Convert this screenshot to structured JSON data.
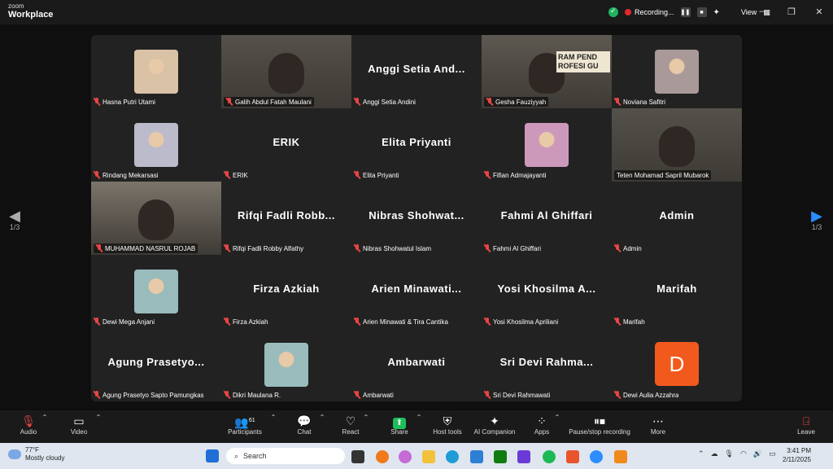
{
  "app": {
    "brand_top": "zoom",
    "brand_bottom": "Workplace",
    "recording_label": "Recording...",
    "view_label": "View"
  },
  "page_indicator": {
    "left": "1/3",
    "right": "1/3"
  },
  "tiles": [
    {
      "label": "Hasna Putri Utami",
      "type": "photo"
    },
    {
      "label": "Galih Abdul Fatah Maulani",
      "type": "video"
    },
    {
      "label": "Anggi Setia Andini",
      "type": "name",
      "big": "Anggi Setia And..."
    },
    {
      "label": "Gesha Fauziyyah",
      "type": "video",
      "sign": "RAM PEND ROFESI GU"
    },
    {
      "label": "Noviana Safitri",
      "type": "photo"
    },
    {
      "label": "Rindang Mekarsasi",
      "type": "photo"
    },
    {
      "label": "ERIK",
      "type": "name",
      "big": "ERIK"
    },
    {
      "label": "Elita Priyanti",
      "type": "name",
      "big": "Elita Priyanti"
    },
    {
      "label": "Fifian Admajayanti",
      "type": "photo"
    },
    {
      "label": "Teten Mohamad Sapril Mubarok",
      "type": "video",
      "active": true
    },
    {
      "label": "MUHAMMAD NASRUL ROJAB",
      "type": "video"
    },
    {
      "label": "Rifqi Fadli Robby Alfathy",
      "type": "name",
      "big": "Rifqi Fadli Robb..."
    },
    {
      "label": "Nibras Shohwatul Islam",
      "type": "name",
      "big": "Nibras Shohwat..."
    },
    {
      "label": "Fahmi Al Ghiffari",
      "type": "name",
      "big": "Fahmi Al Ghiffari"
    },
    {
      "label": "Admin",
      "type": "name",
      "big": "Admin"
    },
    {
      "label": "Dewi Mega Anjani",
      "type": "photo"
    },
    {
      "label": "Firza Azkiah",
      "type": "name",
      "big": "Firza Azkiah"
    },
    {
      "label": "Arien Minawati & Tira Cantika",
      "type": "name",
      "big": "Arien Minawati..."
    },
    {
      "label": "Yosi Khosilma Apriliani",
      "type": "name",
      "big": "Yosi Khosilma A..."
    },
    {
      "label": "Marifah",
      "type": "name",
      "big": "Marifah"
    },
    {
      "label": "Agung Prasetyo Sapto Pamungkas",
      "type": "name",
      "big": "Agung Prasetyo..."
    },
    {
      "label": "Dikri Maulana R.",
      "type": "photo"
    },
    {
      "label": "Ambarwati",
      "type": "name",
      "big": "Ambarwati"
    },
    {
      "label": "Sri Devi Rahmawati",
      "type": "name",
      "big": "Sri Devi Rahma..."
    },
    {
      "label": "Dewi Aulia Azzahra",
      "type": "letter",
      "letter": "D"
    }
  ],
  "toolbar": {
    "audio": "Audio",
    "video": "Video",
    "participants": "Participants",
    "participants_count": "61",
    "chat": "Chat",
    "react": "React",
    "share": "Share",
    "host_tools": "Host tools",
    "ai_companion": "AI Companion",
    "apps": "Apps",
    "pause_stop": "Pause/stop recording",
    "more": "More",
    "leave": "Leave"
  },
  "taskbar": {
    "temp": "77°F",
    "weather": "Mostly cloudy",
    "search_placeholder": "Search",
    "time": "3:41 PM",
    "date": "2/11/2025"
  },
  "colors": {
    "active_border": "#25d07d",
    "mic_muted": "#e84545",
    "avatar_d": "#f25a1d",
    "share_green": "#1fbf5c"
  }
}
